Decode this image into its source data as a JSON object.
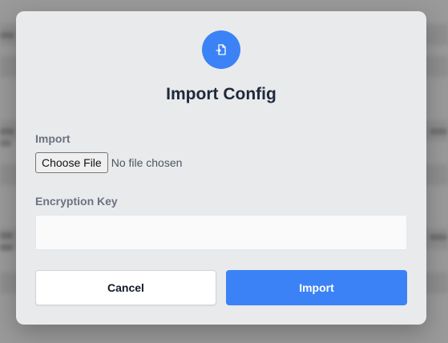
{
  "dialog": {
    "title": "Import Config",
    "icon": "file-import-icon",
    "accent_color": "#3b82f6"
  },
  "import_field": {
    "label": "Import",
    "choose_button_label": "Choose File",
    "status_text": "No file chosen"
  },
  "encryption_field": {
    "label": "Encryption Key",
    "value": "",
    "placeholder": ""
  },
  "actions": {
    "cancel_label": "Cancel",
    "import_label": "Import"
  }
}
